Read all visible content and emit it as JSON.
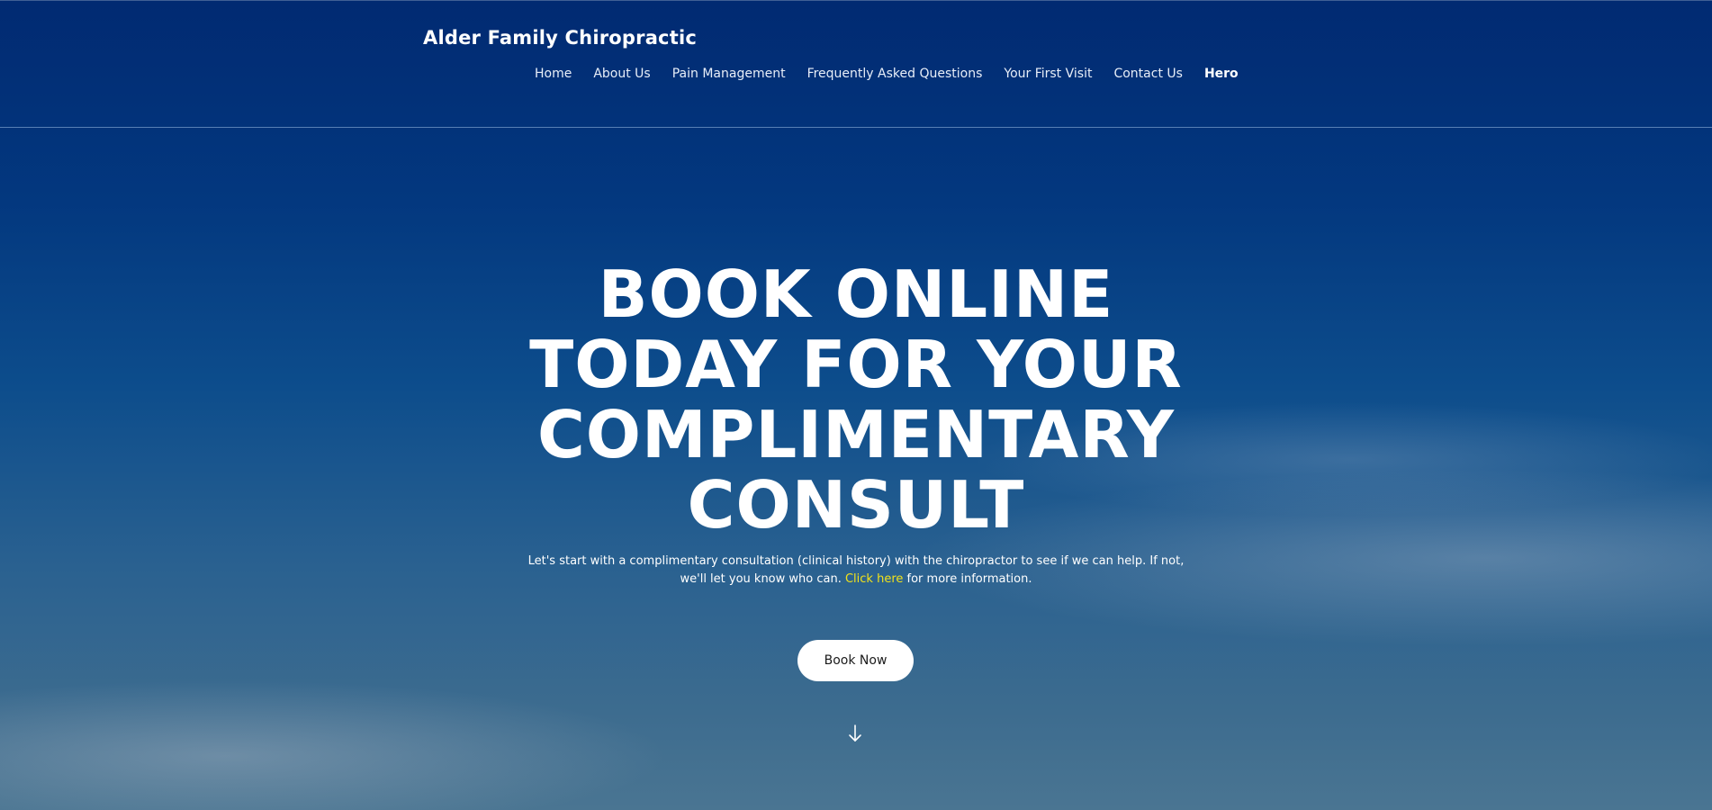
{
  "header": {
    "site_title": "Alder Family Chiropractic",
    "nav": [
      {
        "label": "Home"
      },
      {
        "label": "About Us"
      },
      {
        "label": "Pain Management"
      },
      {
        "label": "Frequently Asked Questions"
      },
      {
        "label": "Your First Visit"
      },
      {
        "label": "Contact Us"
      },
      {
        "label": "Hero",
        "active": true
      }
    ]
  },
  "hero": {
    "heading_lines": [
      "BOOK ONLINE",
      "TODAY FOR YOUR",
      "COMPLIMENTARY",
      "CONSULT"
    ],
    "text_before_link": "Let's start with a complimentary consultation (clinical history) with the chiropractor to see if we can help. If not, we'll let you know who can. ",
    "link_text": "Click here",
    "text_after_link": " for more information.",
    "button_label": "Book Now",
    "scroll_icon": "arrow-down-icon"
  },
  "colors": {
    "background_top": "#012a72",
    "background_bottom": "#4a7592",
    "link": "#f2e21a",
    "button_bg": "#ffffff",
    "button_text": "#1b1b1b"
  }
}
